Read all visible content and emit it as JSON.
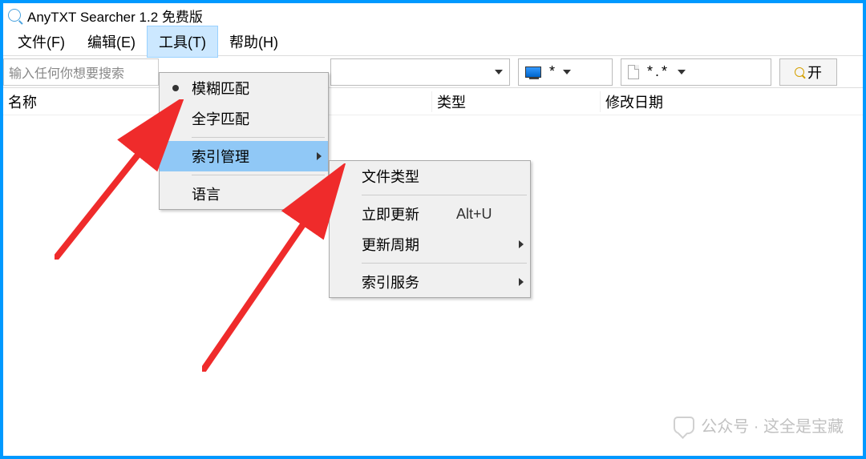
{
  "title": "AnyTXT Searcher 1.2 免费版",
  "menu": {
    "file": "文件(F)",
    "edit": "编辑(E)",
    "tools": "工具(T)",
    "help": "帮助(H)"
  },
  "toolbar": {
    "search_placeholder": "输入任何你想要搜索",
    "drive_filter": "*",
    "ext_filter": "*.*",
    "search_btn": "开"
  },
  "columns": {
    "name": "名称",
    "type": "类型",
    "date": "修改日期"
  },
  "tools_menu": {
    "fuzzy": "模糊匹配",
    "whole": "全字匹配",
    "index": "索引管理",
    "lang": "语言"
  },
  "index_menu": {
    "file_type": "文件类型",
    "update_now": "立即更新",
    "update_now_key": "Alt+U",
    "update_cycle": "更新周期",
    "index_service": "索引服务"
  },
  "watermark": "公众号 · 这全是宝藏"
}
